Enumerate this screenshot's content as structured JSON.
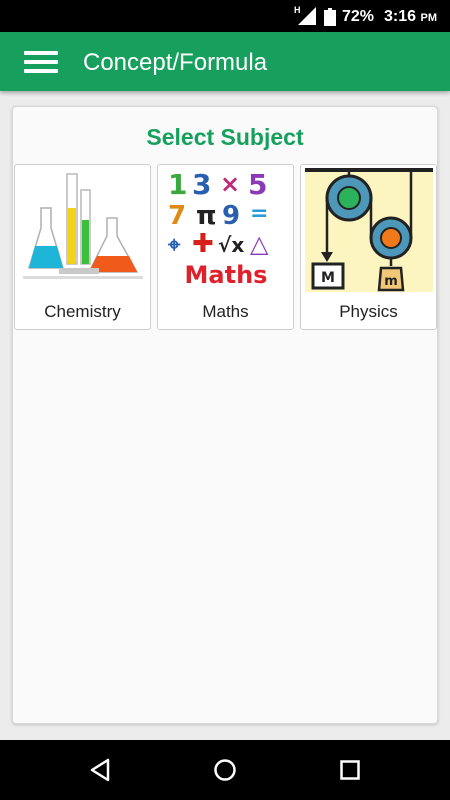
{
  "status_bar": {
    "network_type": "H",
    "battery_percent": "72%",
    "time": "3:16",
    "ampm": "PM"
  },
  "app_bar": {
    "title": "Concept/Formula",
    "menu_icon": "hamburger-menu-icon"
  },
  "main": {
    "section_title": "Select Subject",
    "subjects": [
      {
        "label": "Chemistry",
        "image": "chemistry-glassware-image"
      },
      {
        "label": "Maths",
        "image": "maths-symbols-image",
        "image_text": "Maths"
      },
      {
        "label": "Physics",
        "image": "pulley-system-image",
        "image_labels": [
          "M",
          "m"
        ]
      }
    ]
  },
  "nav_bar": {
    "back_icon": "back-triangle-icon",
    "home_icon": "home-circle-icon",
    "recents_icon": "recents-square-icon"
  },
  "colors": {
    "primary": "#17a05d",
    "status_bar": "#000000",
    "background": "#ececec"
  }
}
